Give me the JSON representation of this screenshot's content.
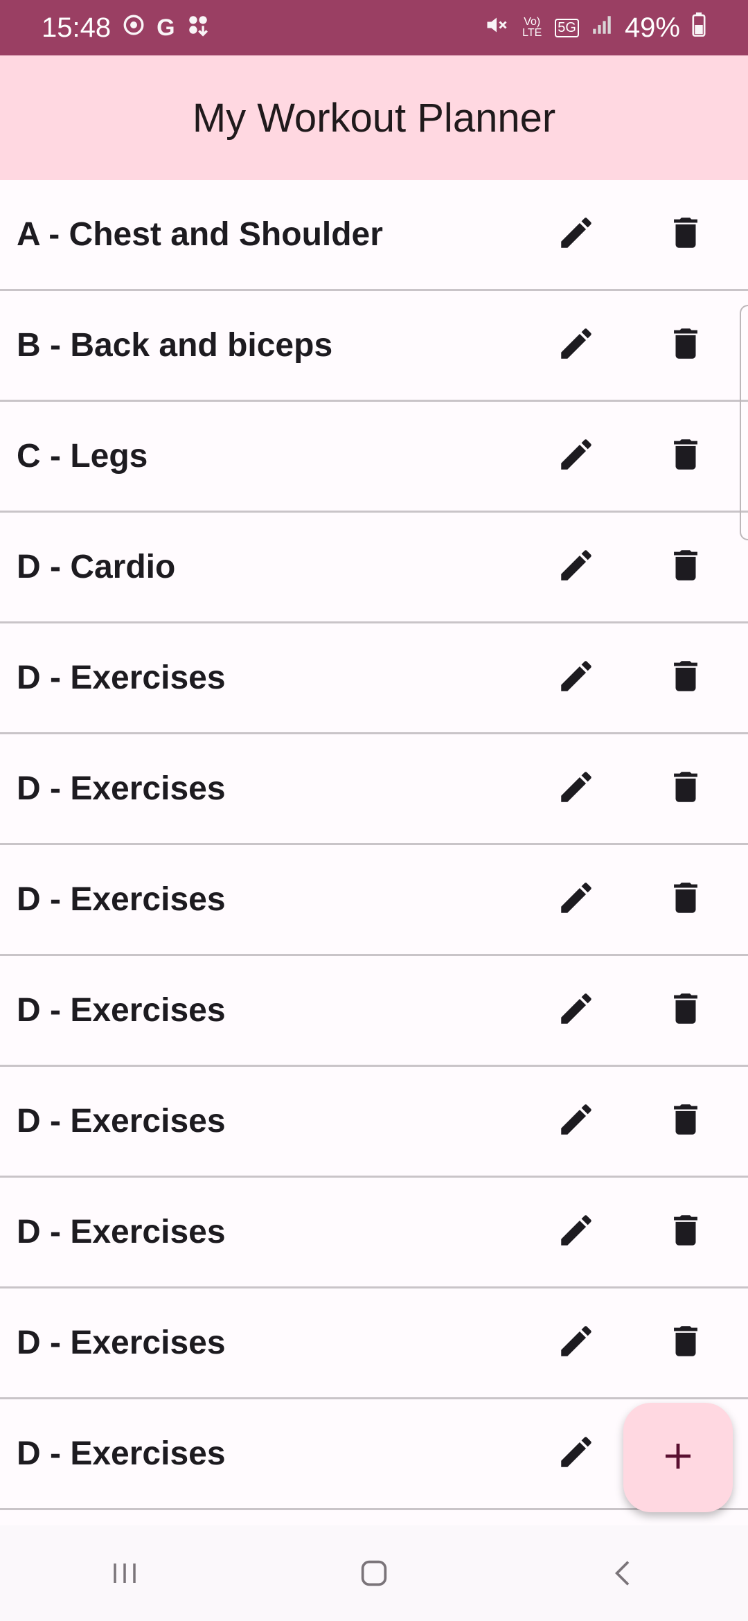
{
  "status_bar": {
    "time": "15:48",
    "g_label": "G",
    "volte_label": "Vo) LTE",
    "network_label": "5G",
    "battery": "49%"
  },
  "app_bar": {
    "title": "My Workout Planner"
  },
  "workouts": [
    "A - Chest and Shoulder",
    "B - Back and biceps",
    "C - Legs",
    "D - Cardio",
    "D - Exercises",
    "D - Exercises",
    "D - Exercises",
    "D - Exercises",
    "D - Exercises",
    "D - Exercises",
    "D - Exercises",
    "D - Exercises"
  ],
  "icons": {
    "edit": "pencil-icon",
    "delete": "trash-icon",
    "fab": "plus-icon"
  },
  "colors": {
    "status_bar": "#9a3f63",
    "app_bar": "#ffd8e1",
    "fab": "#ffd8e1",
    "fab_icon": "#5a0f30",
    "background": "#fffbfe"
  }
}
